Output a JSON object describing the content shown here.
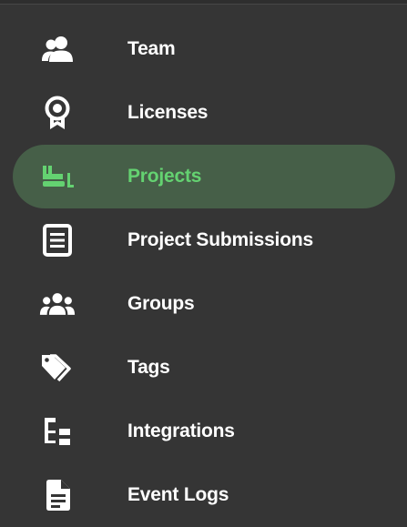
{
  "colors": {
    "background": "#353535",
    "text": "#ffffff",
    "active_bg": "#465f48",
    "active_text": "#64d271"
  },
  "nav": {
    "active_index": 2,
    "items": [
      {
        "label": "Team",
        "icon": "team-icon"
      },
      {
        "label": "Licenses",
        "icon": "license-icon"
      },
      {
        "label": "Projects",
        "icon": "bulldozer-icon"
      },
      {
        "label": "Project Submissions",
        "icon": "document-list-icon"
      },
      {
        "label": "Groups",
        "icon": "groups-icon"
      },
      {
        "label": "Tags",
        "icon": "tags-icon"
      },
      {
        "label": "Integrations",
        "icon": "hierarchy-icon"
      },
      {
        "label": "Event Logs",
        "icon": "file-text-icon"
      }
    ]
  }
}
